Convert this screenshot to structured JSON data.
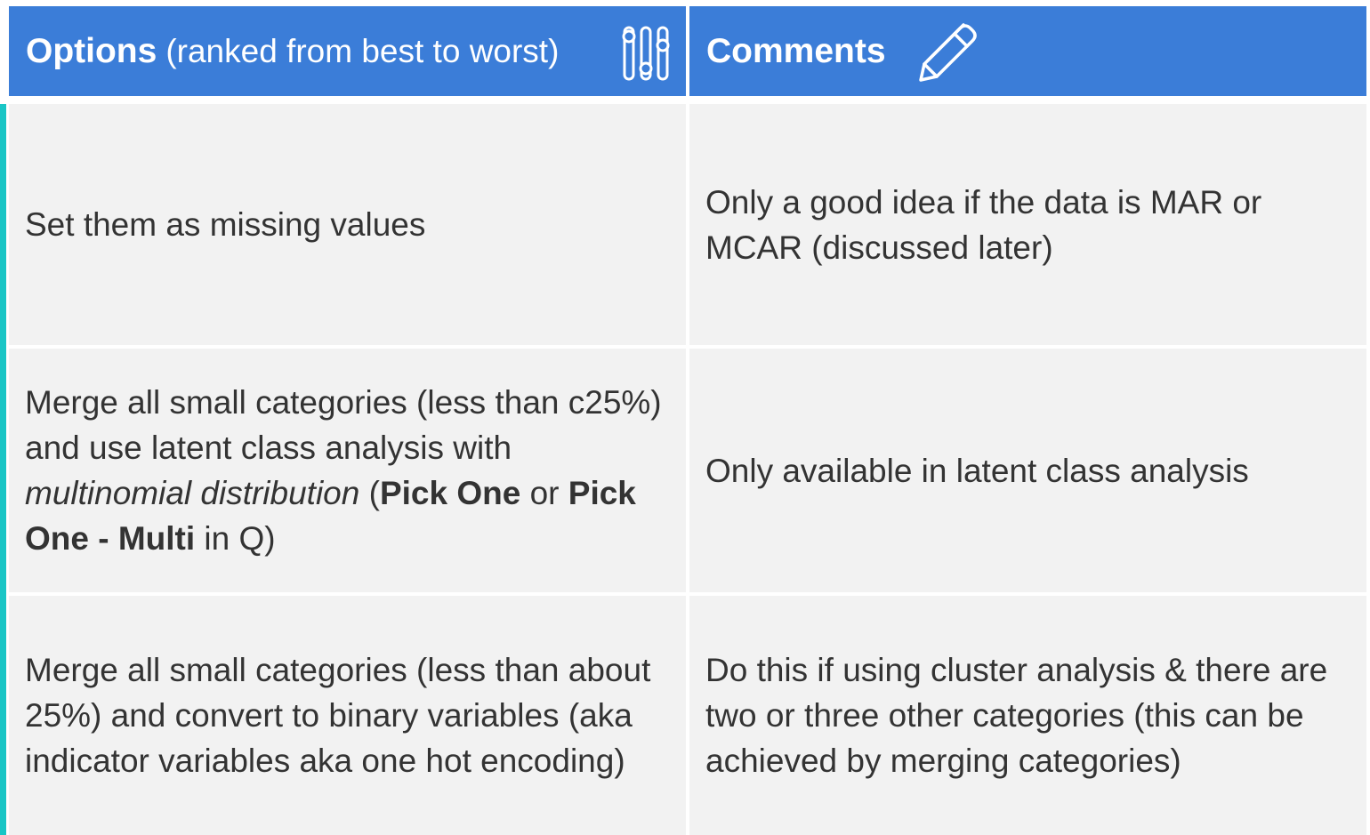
{
  "header": {
    "options_title": "Options",
    "options_subtitle": "(ranked from best to worst)",
    "comments_title": "Comments",
    "options_icon": "sliders-icon",
    "comments_icon": "pencil-icon"
  },
  "colors": {
    "header_bg": "#3b7dd8",
    "cell_bg": "#f2f2f2",
    "accent_bar": "#19c6c6",
    "text": "#333333"
  },
  "rows": [
    {
      "option": {
        "text": "Set them as missing values"
      },
      "comment": "Only a good idea if the data is MAR or MCAR (discussed later)"
    },
    {
      "option": {
        "part1": "Merge all small categories (less than c25%) and use latent class analysis with ",
        "italic": "multinomial distribution",
        "part2": " (",
        "bold1": "Pick One",
        "part3": " or ",
        "bold2": "Pick One - Multi",
        "part4": " in Q)"
      },
      "comment": "Only available in latent class analysis"
    },
    {
      "option": {
        "text": "Merge all small categories (less than about 25%) and convert to binary variables (aka indicator variables aka one hot encoding)"
      },
      "comment": "Do this if using cluster analysis & there are two or three other categories (this can be achieved by merging categories)"
    }
  ]
}
